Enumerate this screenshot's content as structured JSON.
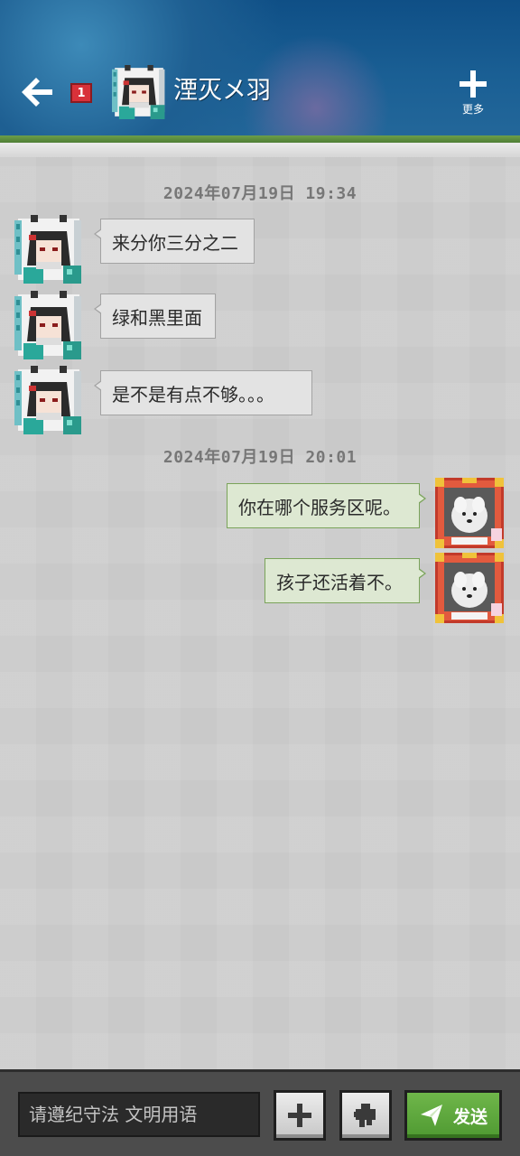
{
  "header": {
    "unread_count": "1",
    "contact_name": "湮灭メ羽",
    "more_label": "更多"
  },
  "messages": [
    {
      "type": "timestamp",
      "text": "2024年07月19日 19:34"
    },
    {
      "type": "incoming",
      "text": "来分你三分之二"
    },
    {
      "type": "incoming",
      "text": "绿和黑里面"
    },
    {
      "type": "incoming",
      "text": "是不是有点不够。。。"
    },
    {
      "type": "timestamp",
      "text": "2024年07月19日 20:01"
    },
    {
      "type": "outgoing",
      "text": "你在哪个服务区呢。"
    },
    {
      "type": "outgoing",
      "text": "孩子还活着不。"
    }
  ],
  "input": {
    "placeholder": "请遵纪守法 文明用语",
    "value": ""
  },
  "send_label": "发送",
  "colors": {
    "header_blue": "#1a5f94",
    "accent_green": "#5ca63c",
    "incoming_bubble": "#e3e3e3",
    "outgoing_bubble": "#dde8d2",
    "badge_red": "#d8313a"
  },
  "icons": {
    "back": "arrow-left-icon",
    "more": "plus-icon",
    "attach": "plus-icon",
    "emoji": "puzzle-icon",
    "send": "paper-plane-icon"
  }
}
